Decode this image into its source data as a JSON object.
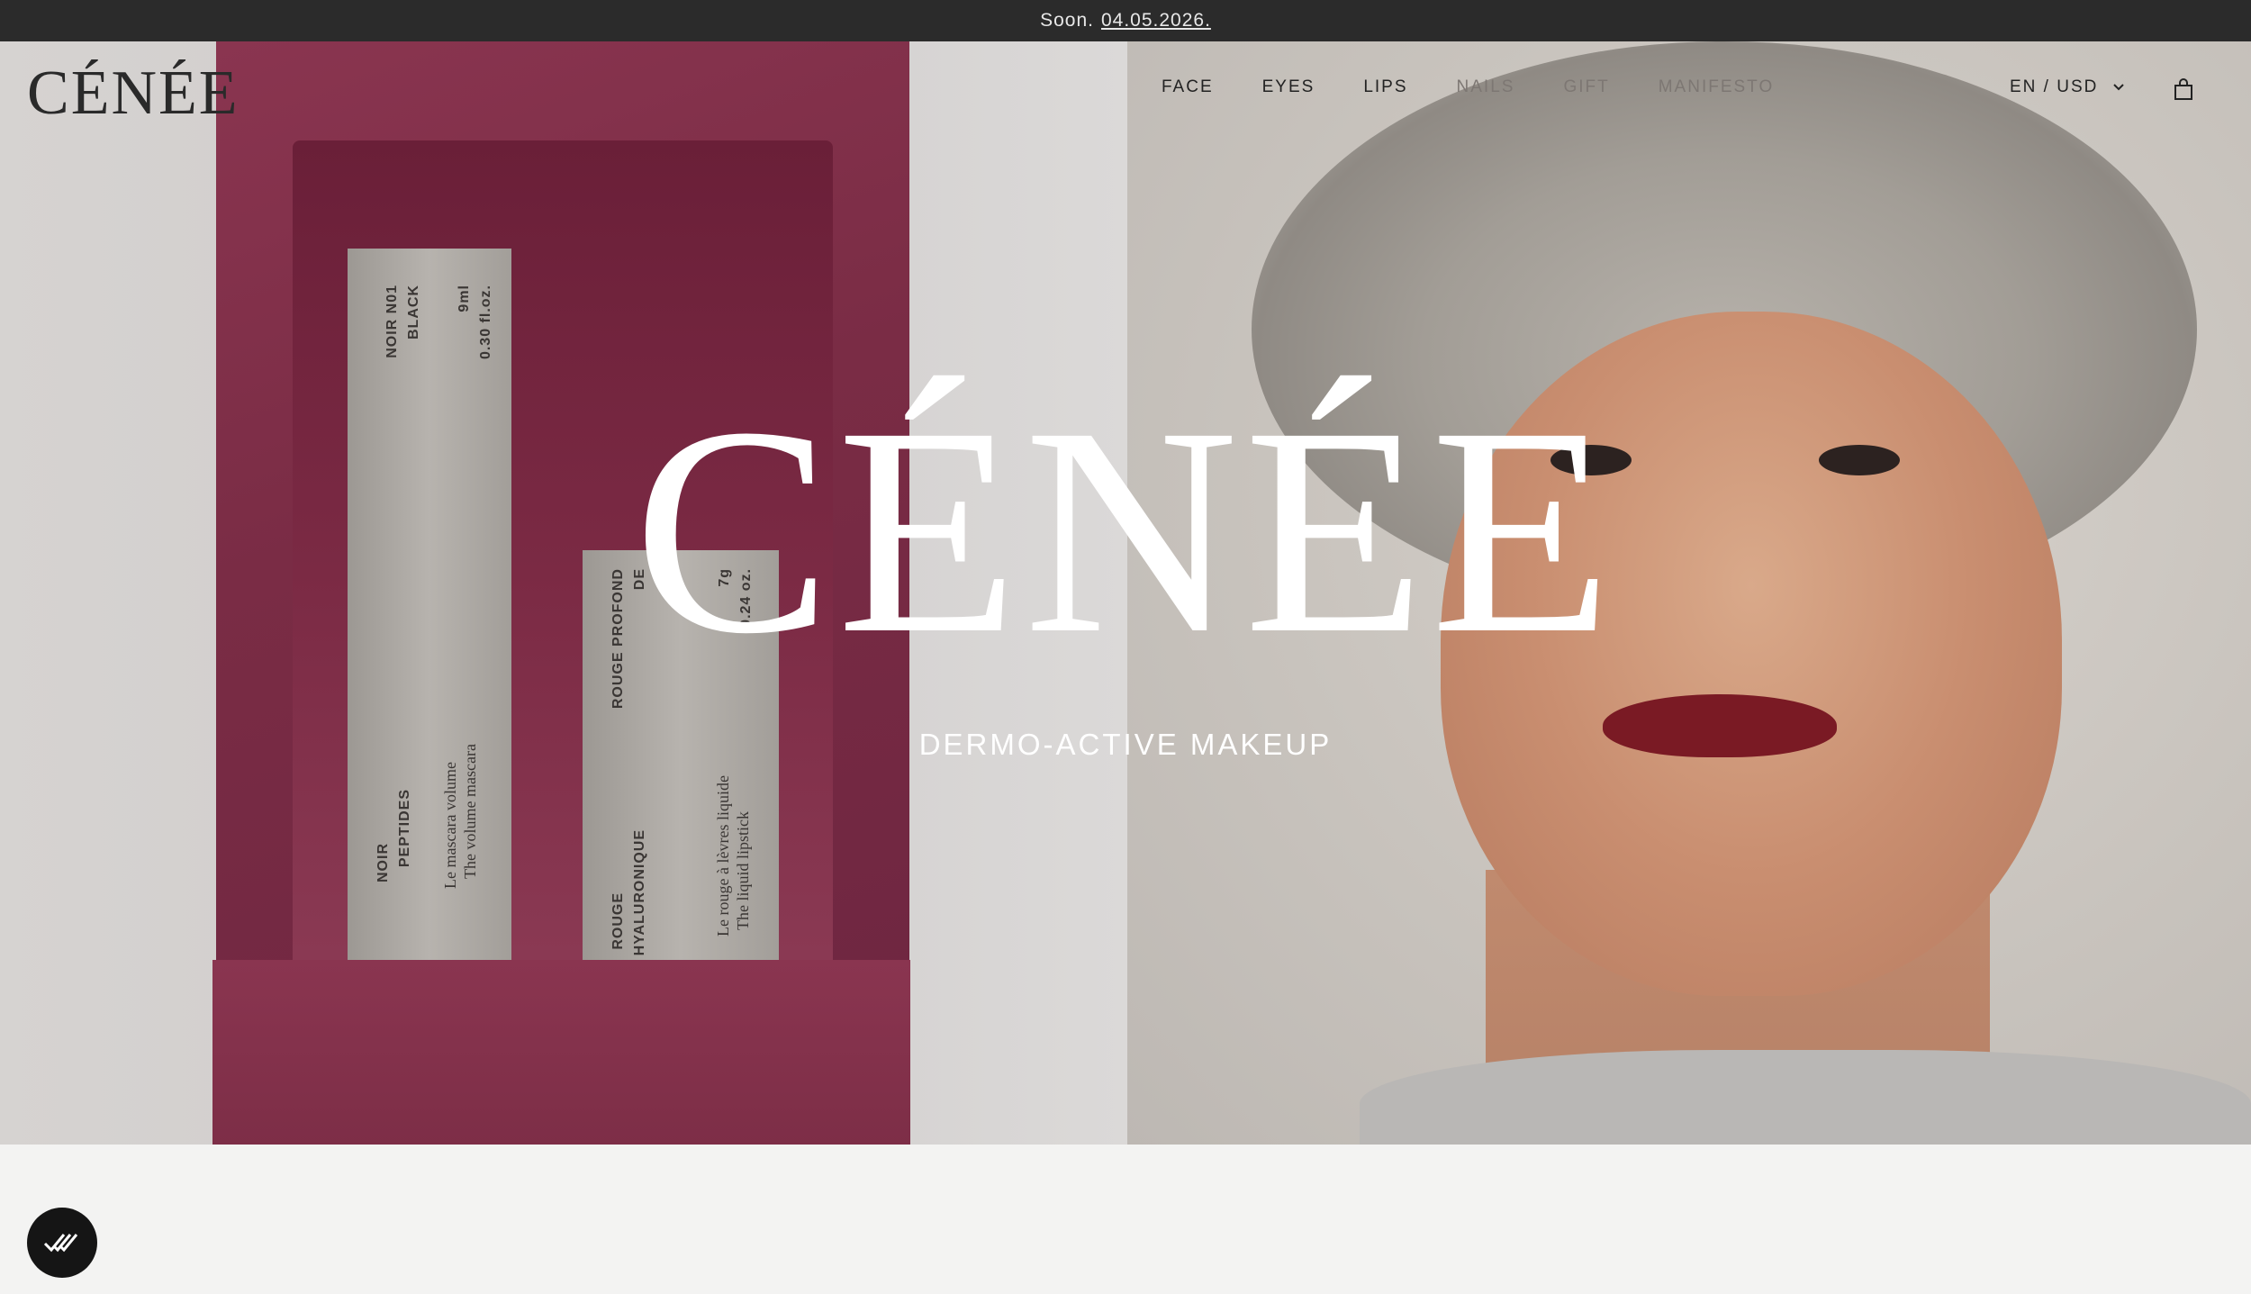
{
  "announcement": {
    "prefix": "Soon.",
    "date": "04.05.2026."
  },
  "header": {
    "logo": "CÉNÉE",
    "nav": [
      {
        "label": "FACE"
      },
      {
        "label": "EYES"
      },
      {
        "label": "LIPS"
      },
      {
        "label": "NAILS"
      },
      {
        "label": "GIFT"
      },
      {
        "label": "MANIFESTO"
      }
    ],
    "locale": "EN / USD",
    "cart_icon": "bag-icon"
  },
  "hero": {
    "logo": "CÉNÉE",
    "tagline": "DERMO-ACTIVE MAKEUP",
    "product1": {
      "shade": "NOIR N01",
      "shade_sub": "BLACK",
      "volume": "9ml",
      "volume_oz": "0.30 fl.oz.",
      "name": "NOIR",
      "name_sub": "PEPTIDES",
      "desc_fr": "Le mascara volume",
      "desc_en": "The volume mascara"
    },
    "product2": {
      "shade": "ROUGE PROFOND",
      "shade_sub": "DE",
      "weight": "7g",
      "weight_oz": "0.24 oz.",
      "name": "ROUGE",
      "name_sub": "HYALURONIQUE",
      "desc_fr": "Le rouge à lèvres liquide",
      "desc_en": "The liquid lipstick"
    }
  },
  "badge": {
    "icon": "checkmarks-icon"
  },
  "colors": {
    "announcement_bg": "#2b2b2b",
    "brand_burgundy": "#7a2c45",
    "hero_text": "#ffffff"
  }
}
